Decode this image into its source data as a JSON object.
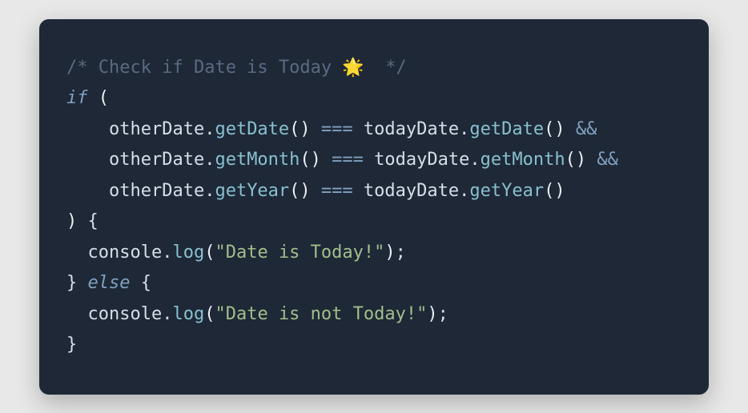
{
  "code": {
    "comment_open": "/* ",
    "comment_text": "Check if Date is Today ",
    "comment_emoji": "🌟",
    "comment_close": "  */",
    "kw_if": "if",
    "kw_else": "else",
    "var_otherDate": "otherDate",
    "var_todayDate": "todayDate",
    "var_console": "console",
    "method_getDate": "getDate",
    "method_getMonth": "getMonth",
    "method_getYear": "getYear",
    "method_log": "log",
    "op_eq": "===",
    "op_and": "&&",
    "string_today": "\"Date is Today!\"",
    "string_not_today": "\"Date is not Today!\"",
    "dot": ".",
    "paren_open": "(",
    "paren_close": ")",
    "brace_open": "{",
    "brace_close": "}",
    "semicolon": ";",
    "indent1": "  ",
    "indent2": "    ",
    "space": " ",
    "empty_parens": "()"
  }
}
